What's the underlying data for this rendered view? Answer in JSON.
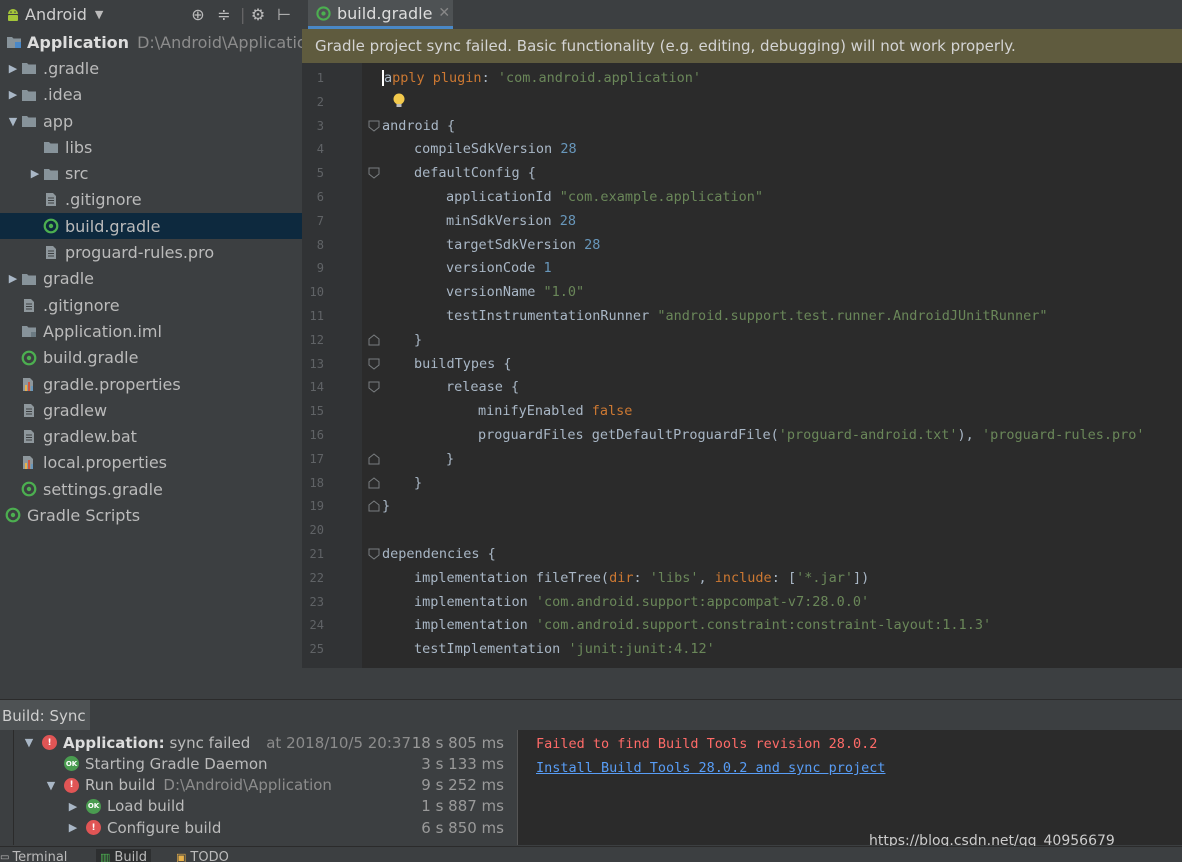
{
  "sidebar": {
    "view_mode": "Android",
    "tree": [
      {
        "indent": 0,
        "arrow": "",
        "icon": "module",
        "label": "Application",
        "bold": true,
        "path": "D:\\Android\\Application"
      },
      {
        "indent": 0,
        "arrow": "right",
        "icon": "folder",
        "label": ".gradle"
      },
      {
        "indent": 0,
        "arrow": "right",
        "icon": "folder",
        "label": ".idea"
      },
      {
        "indent": 0,
        "arrow": "down",
        "icon": "folder",
        "label": "app"
      },
      {
        "indent": 1,
        "arrow": "",
        "icon": "folder",
        "label": "libs"
      },
      {
        "indent": 1,
        "arrow": "right",
        "icon": "folder",
        "label": "src"
      },
      {
        "indent": 1,
        "arrow": "",
        "icon": "file",
        "label": ".gitignore"
      },
      {
        "indent": 1,
        "arrow": "",
        "icon": "gradle",
        "label": "build.gradle",
        "selected": true
      },
      {
        "indent": 1,
        "arrow": "",
        "icon": "file",
        "label": "proguard-rules.pro"
      },
      {
        "indent": 0,
        "arrow": "right",
        "icon": "folder",
        "label": "gradle"
      },
      {
        "indent": 0,
        "arrow": "",
        "icon": "file",
        "label": ".gitignore"
      },
      {
        "indent": 0,
        "arrow": "",
        "icon": "module-file",
        "label": "Application.iml"
      },
      {
        "indent": 0,
        "arrow": "",
        "icon": "gradle",
        "label": "build.gradle"
      },
      {
        "indent": 0,
        "arrow": "",
        "icon": "properties",
        "label": "gradle.properties"
      },
      {
        "indent": 0,
        "arrow": "",
        "icon": "file",
        "label": "gradlew"
      },
      {
        "indent": 0,
        "arrow": "",
        "icon": "file",
        "label": "gradlew.bat"
      },
      {
        "indent": 0,
        "arrow": "",
        "icon": "properties",
        "label": "local.properties"
      },
      {
        "indent": 0,
        "arrow": "",
        "icon": "gradle",
        "label": "settings.gradle"
      },
      {
        "indent": -1,
        "arrow": "",
        "icon": "gradle",
        "label": "Gradle Scripts"
      }
    ]
  },
  "editor": {
    "tab_label": "build.gradle",
    "banner": "Gradle project sync failed. Basic functionality (e.g. editing, debugging) will not work properly.",
    "lines": [
      {
        "n": "1",
        "indent": 0,
        "fold": "",
        "tokens": [
          [
            "caret",
            "a"
          ],
          [
            "kw",
            "pply"
          ],
          [
            "plain",
            " "
          ],
          [
            "kw",
            "plugin"
          ],
          [
            "plain",
            ": "
          ],
          [
            "str",
            "'com.android.application'"
          ]
        ]
      },
      {
        "n": "2",
        "indent": 0,
        "fold": "",
        "bulb": true,
        "tokens": []
      },
      {
        "n": "3",
        "indent": 0,
        "fold": "open",
        "tokens": [
          [
            "plain",
            "android {"
          ]
        ]
      },
      {
        "n": "4",
        "indent": 1,
        "fold": "",
        "tokens": [
          [
            "plain",
            "compileSdkVersion "
          ],
          [
            "num",
            "28"
          ]
        ]
      },
      {
        "n": "5",
        "indent": 1,
        "fold": "open",
        "tokens": [
          [
            "plain",
            "defaultConfig {"
          ]
        ]
      },
      {
        "n": "6",
        "indent": 2,
        "fold": "",
        "tokens": [
          [
            "plain",
            "applicationId "
          ],
          [
            "str",
            "\"com.example.application\""
          ]
        ]
      },
      {
        "n": "7",
        "indent": 2,
        "fold": "",
        "tokens": [
          [
            "plain",
            "minSdkVersion "
          ],
          [
            "num",
            "28"
          ]
        ]
      },
      {
        "n": "8",
        "indent": 2,
        "fold": "",
        "tokens": [
          [
            "plain",
            "targetSdkVersion "
          ],
          [
            "num",
            "28"
          ]
        ]
      },
      {
        "n": "9",
        "indent": 2,
        "fold": "",
        "tokens": [
          [
            "plain",
            "versionCode "
          ],
          [
            "num",
            "1"
          ]
        ]
      },
      {
        "n": "10",
        "indent": 2,
        "fold": "",
        "tokens": [
          [
            "plain",
            "versionName "
          ],
          [
            "str",
            "\"1.0\""
          ]
        ]
      },
      {
        "n": "11",
        "indent": 2,
        "fold": "",
        "tokens": [
          [
            "plain",
            "testInstrumentationRunner "
          ],
          [
            "str",
            "\"android.support.test.runner.AndroidJUnitRunner\""
          ]
        ]
      },
      {
        "n": "12",
        "indent": 1,
        "fold": "close",
        "tokens": [
          [
            "plain",
            "}"
          ]
        ]
      },
      {
        "n": "13",
        "indent": 1,
        "fold": "open",
        "tokens": [
          [
            "plain",
            "buildTypes {"
          ]
        ]
      },
      {
        "n": "14",
        "indent": 2,
        "fold": "open",
        "tokens": [
          [
            "plain",
            "release {"
          ]
        ]
      },
      {
        "n": "15",
        "indent": 3,
        "fold": "",
        "tokens": [
          [
            "plain",
            "minifyEnabled "
          ],
          [
            "kw",
            "false"
          ]
        ]
      },
      {
        "n": "16",
        "indent": 3,
        "fold": "",
        "tokens": [
          [
            "plain",
            "proguardFiles getDefaultProguardFile("
          ],
          [
            "str",
            "'proguard-android.txt'"
          ],
          [
            "plain",
            "), "
          ],
          [
            "str",
            "'proguard-rules.pro'"
          ]
        ]
      },
      {
        "n": "17",
        "indent": 2,
        "fold": "close",
        "tokens": [
          [
            "plain",
            "}"
          ]
        ]
      },
      {
        "n": "18",
        "indent": 1,
        "fold": "close",
        "tokens": [
          [
            "plain",
            "}"
          ]
        ]
      },
      {
        "n": "19",
        "indent": 0,
        "fold": "close",
        "tokens": [
          [
            "plain",
            "}"
          ]
        ]
      },
      {
        "n": "20",
        "indent": 0,
        "fold": "",
        "tokens": []
      },
      {
        "n": "21",
        "indent": 0,
        "fold": "open",
        "tokens": [
          [
            "plain",
            "dependencies {"
          ]
        ]
      },
      {
        "n": "22",
        "indent": 1,
        "fold": "",
        "tokens": [
          [
            "plain",
            "implementation fileTree("
          ],
          [
            "kw",
            "dir"
          ],
          [
            "plain",
            ": "
          ],
          [
            "str",
            "'libs'"
          ],
          [
            "plain",
            ", "
          ],
          [
            "kw",
            "include"
          ],
          [
            "plain",
            ": ["
          ],
          [
            "str",
            "'*.jar'"
          ],
          [
            "plain",
            "])"
          ]
        ]
      },
      {
        "n": "23",
        "indent": 1,
        "fold": "",
        "tokens": [
          [
            "plain",
            "implementation "
          ],
          [
            "str",
            "'com.android.support:appcompat-v7:28.0.0'"
          ]
        ]
      },
      {
        "n": "24",
        "indent": 1,
        "fold": "",
        "tokens": [
          [
            "plain",
            "implementation "
          ],
          [
            "str",
            "'com.android.support.constraint:constraint-layout:1.1.3'"
          ]
        ]
      },
      {
        "n": "25",
        "indent": 1,
        "fold": "",
        "tokens": [
          [
            "plain",
            "testImplementation "
          ],
          [
            "str",
            "'junit:junit:4.12'"
          ]
        ]
      }
    ]
  },
  "build": {
    "panel_title": "Build: Sync",
    "rows": [
      {
        "level": 0,
        "arrow": "down",
        "status": "error",
        "label": "Application:",
        "label_rest": " sync failed",
        "sub": "at 2018/10/5 20:37",
        "time": "18 s 805 ms"
      },
      {
        "level": 1,
        "arrow": "",
        "status": "ok",
        "label": "Starting Gradle Daemon",
        "time": "3 s 133 ms"
      },
      {
        "level": 1,
        "arrow": "down",
        "status": "error",
        "label": "Run build",
        "sub": "D:\\Android\\Application",
        "time": "9 s 252 ms"
      },
      {
        "level": 2,
        "arrow": "right",
        "status": "ok",
        "label": "Load build",
        "time": "1 s 887 ms"
      },
      {
        "level": 2,
        "arrow": "right",
        "status": "error",
        "label": "Configure build",
        "time": "6 s 850 ms"
      }
    ],
    "console_error": "Failed to find Build Tools revision 28.0.2",
    "console_link": "Install Build Tools 28.0.2 and sync project"
  },
  "watermark": "https://blog.csdn.net/qq_40956679",
  "bottom_tabs": [
    "Terminal",
    "Build",
    "TODO"
  ]
}
